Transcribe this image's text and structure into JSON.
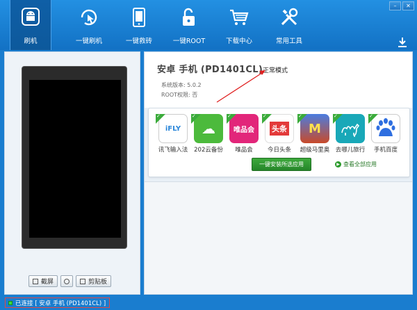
{
  "window": {
    "minimize": "–",
    "close": "✕"
  },
  "nav": [
    {
      "label": "刷机",
      "icon": "android-icon",
      "active": true
    },
    {
      "label": "一键刷机",
      "icon": "touch-refresh-icon",
      "active": false
    },
    {
      "label": "一键救砖",
      "icon": "phone-repair-icon",
      "active": false
    },
    {
      "label": "一键ROOT",
      "icon": "unlock-icon",
      "active": false
    },
    {
      "label": "下载中心",
      "icon": "cart-icon",
      "active": false
    },
    {
      "label": "常用工具",
      "icon": "tools-icon",
      "active": false
    }
  ],
  "left": {
    "screenshot_label": "截屏",
    "clipboard_label": "剪贴板"
  },
  "device": {
    "title": "安卓 手机 (PD1401CL)",
    "mode": "正常模式",
    "system_version": "系统版本: 5.0.2",
    "root_status": "ROOT权限: 否"
  },
  "apps": [
    {
      "name": "讯飞输入法",
      "icon_text": "iFLY",
      "color": "#ffffff",
      "fg": "#2a86d9"
    },
    {
      "name": "202云备份",
      "icon_text": "☁",
      "color": "#4cba3c",
      "fg": "#ffffff"
    },
    {
      "name": "唯品会",
      "icon_text": "唯品会",
      "color": "#e2267a",
      "fg": "#ffffff"
    },
    {
      "name": "今日头条",
      "icon_text": "头条",
      "color": "#ffffff",
      "fg": "#e33a3a"
    },
    {
      "name": "超级马里奥",
      "icon_text": "M",
      "color": "#3a6bd0",
      "fg": "#ffe14d"
    },
    {
      "name": "去哪儿旅行",
      "icon_text": "🐫",
      "color": "#19a8b8",
      "fg": "#ffffff"
    },
    {
      "name": "手机百度",
      "icon_text": "du",
      "color": "#ffffff",
      "fg": "#2e6ee0"
    }
  ],
  "actions": {
    "install_selected": "一键安装所选应用",
    "view_all": "查看全部应用"
  },
  "status": {
    "text": "已连接 [ 安卓 手机 (PD1401CL) ]"
  }
}
